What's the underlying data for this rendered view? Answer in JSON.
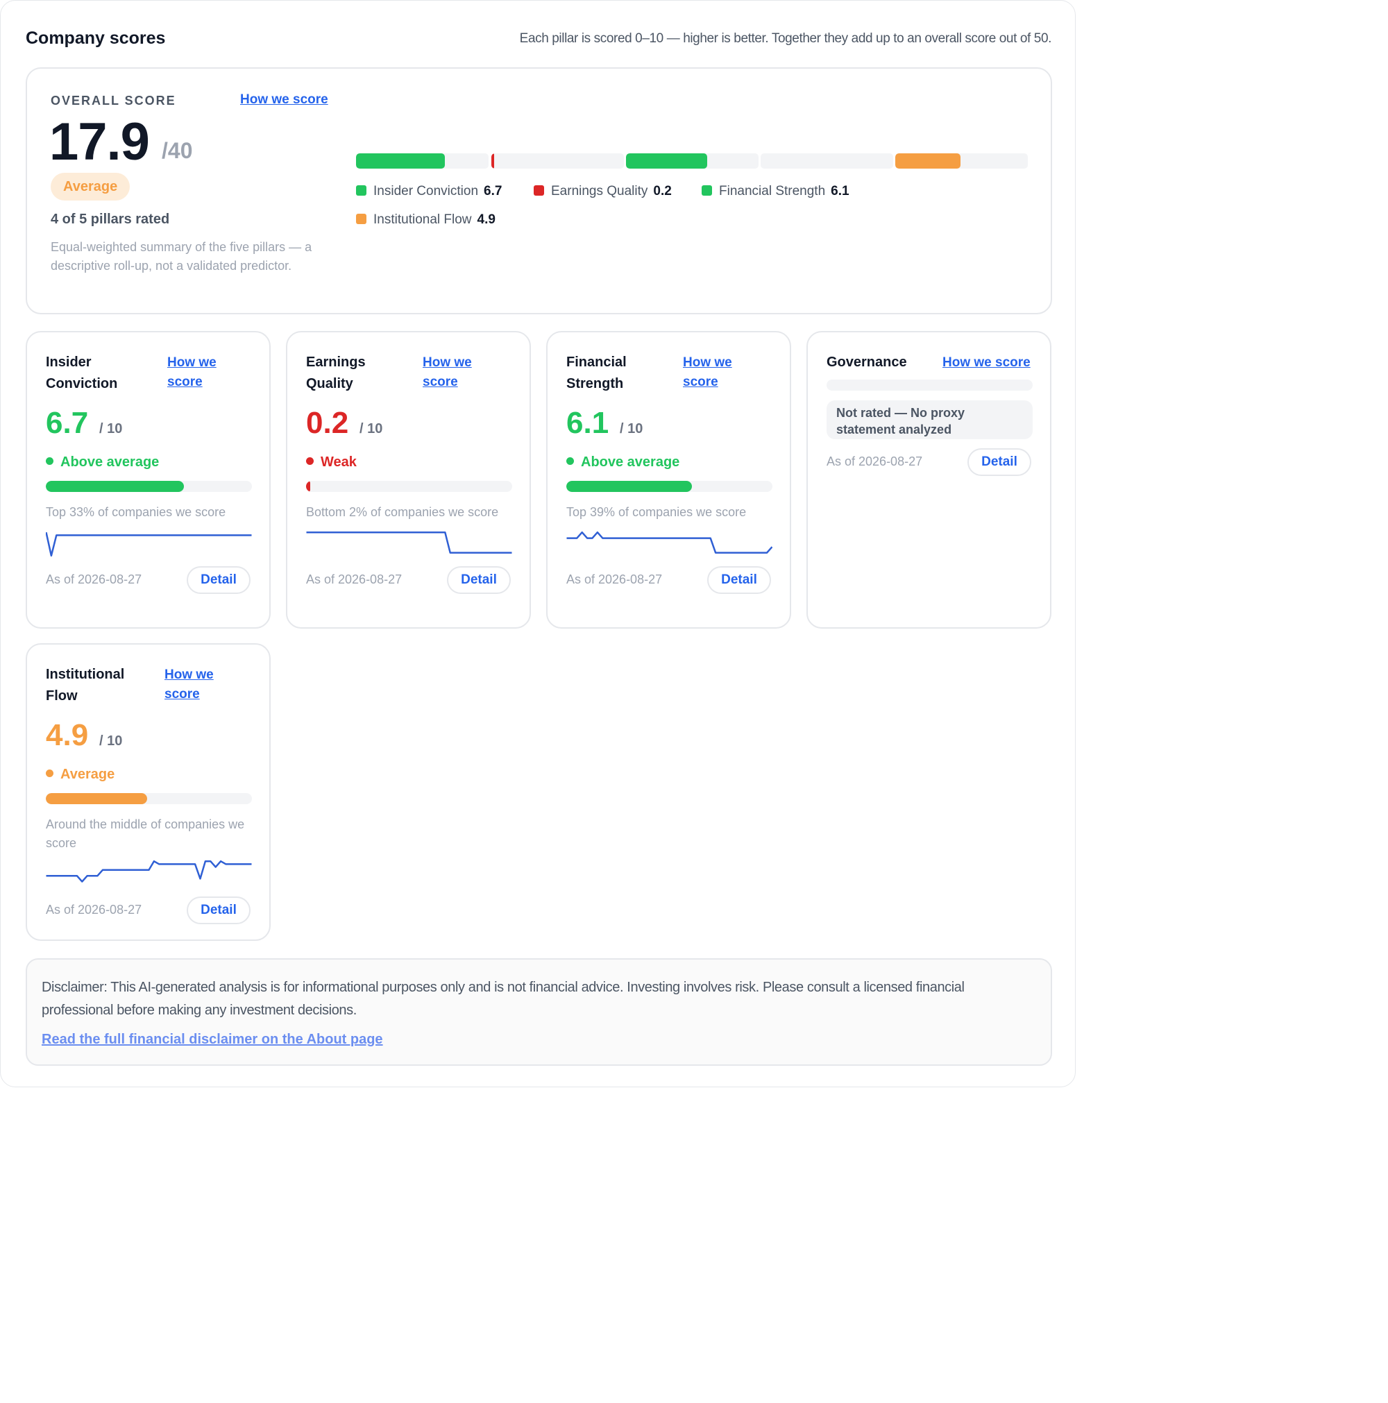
{
  "header": {
    "title": "Company scores",
    "note": "Each pillar is scored 0–10 — higher is better. Together they add up to an overall score out of 50."
  },
  "overall": {
    "label": "OVERALL SCORE",
    "how_link": "How we score",
    "score": "17.9",
    "max": "/40",
    "badge": "Average",
    "rated": "4 of 5 pillars rated",
    "description": "Equal-weighted summary of the five pillars — a descriptive roll-up, not a validated predictor.",
    "segments": [
      {
        "name": "Insider Conviction",
        "value": 6.7,
        "color": "#22c55e"
      },
      {
        "name": "Earnings Quality",
        "value": 0.2,
        "color": "#dc2626"
      },
      {
        "name": "Financial Strength",
        "value": 6.1,
        "color": "#22c55e"
      },
      {
        "name": "Governance",
        "value": null,
        "color": "#f3f4f6"
      },
      {
        "name": "Institutional Flow",
        "value": 4.9,
        "color": "#f59e42"
      }
    ],
    "legend": [
      {
        "name": "Insider Conviction",
        "value": "6.7",
        "color": "#22c55e"
      },
      {
        "name": "Earnings Quality",
        "value": "0.2",
        "color": "#dc2626"
      },
      {
        "name": "Financial Strength",
        "value": "6.1",
        "color": "#22c55e"
      },
      {
        "name": "Institutional Flow",
        "value": "4.9",
        "color": "#f59e42"
      }
    ]
  },
  "pillars": [
    {
      "title": "Insider Conviction",
      "how_link": "How we score",
      "score": "6.7",
      "max": "/ 10",
      "status": "Above average",
      "color": "#22c55e",
      "bar_fraction": 0.67,
      "rank": "Top 33% of companies we score",
      "as_of": "As of 2026-08-27",
      "detail": "Detail",
      "trend": [
        9,
        1,
        8,
        8,
        8,
        8,
        8,
        8,
        8,
        8,
        8,
        8,
        8,
        8,
        8,
        8,
        8,
        8,
        8,
        8,
        8,
        8,
        8,
        8,
        8,
        8,
        8,
        8,
        8,
        8,
        8,
        8,
        8,
        8,
        8,
        8,
        8,
        8,
        8,
        8,
        8
      ]
    },
    {
      "title": "Earnings Quality",
      "how_link": "How we score",
      "score": "0.2",
      "max": "/ 10",
      "status": "Weak",
      "color": "#dc2626",
      "bar_fraction": 0.02,
      "rank": "Bottom 2% of companies we score",
      "as_of": "As of 2026-08-27",
      "detail": "Detail",
      "trend": [
        9,
        9,
        9,
        9,
        9,
        9,
        9,
        9,
        9,
        9,
        9,
        9,
        9,
        9,
        9,
        9,
        9,
        9,
        9,
        9,
        9,
        9,
        9,
        9,
        9,
        9,
        9,
        9,
        2,
        2,
        2,
        2,
        2,
        2,
        2,
        2,
        2,
        2,
        2,
        2,
        2
      ]
    },
    {
      "title": "Financial Strength",
      "how_link": "How we score",
      "score": "6.1",
      "max": "/ 10",
      "status": "Above average",
      "color": "#22c55e",
      "bar_fraction": 0.61,
      "rank": "Top 39% of companies we score",
      "as_of": "As of 2026-08-27",
      "detail": "Detail",
      "trend": [
        7,
        7,
        7,
        9,
        7,
        7,
        9,
        7,
        7,
        7,
        7,
        7,
        7,
        7,
        7,
        7,
        7,
        7,
        7,
        7,
        7,
        7,
        7,
        7,
        7,
        7,
        7,
        7,
        7,
        2,
        2,
        2,
        2,
        2,
        2,
        2,
        2,
        2,
        2,
        2,
        4
      ]
    },
    {
      "title": "Governance",
      "how_link": "How we score",
      "not_rated": "Not rated — No proxy statement analyzed",
      "as_of": "As of 2026-08-27",
      "detail": "Detail"
    },
    {
      "title": "Institutional Flow",
      "how_link": "How we score",
      "score": "4.9",
      "max": "/ 10",
      "status": "Average",
      "color": "#f59e42",
      "bar_fraction": 0.49,
      "rank": "Around the middle of companies we score",
      "as_of": "As of 2026-08-27",
      "detail": "Detail",
      "trend": [
        4,
        4,
        4,
        4,
        4,
        4,
        4,
        2,
        4,
        4,
        4,
        6,
        6,
        6,
        6,
        6,
        6,
        6,
        6,
        6,
        6,
        9,
        8,
        8,
        8,
        8,
        8,
        8,
        8,
        8,
        3,
        9,
        9,
        7,
        9,
        8,
        8,
        8,
        8,
        8,
        8
      ]
    }
  ],
  "disclaimer": {
    "text": "Disclaimer: This AI-generated analysis is for informational purposes only and is not financial advice. Investing involves risk. Please consult a licensed financial professional before making any investment decisions.",
    "link": "Read the full financial disclaimer on the About page"
  }
}
